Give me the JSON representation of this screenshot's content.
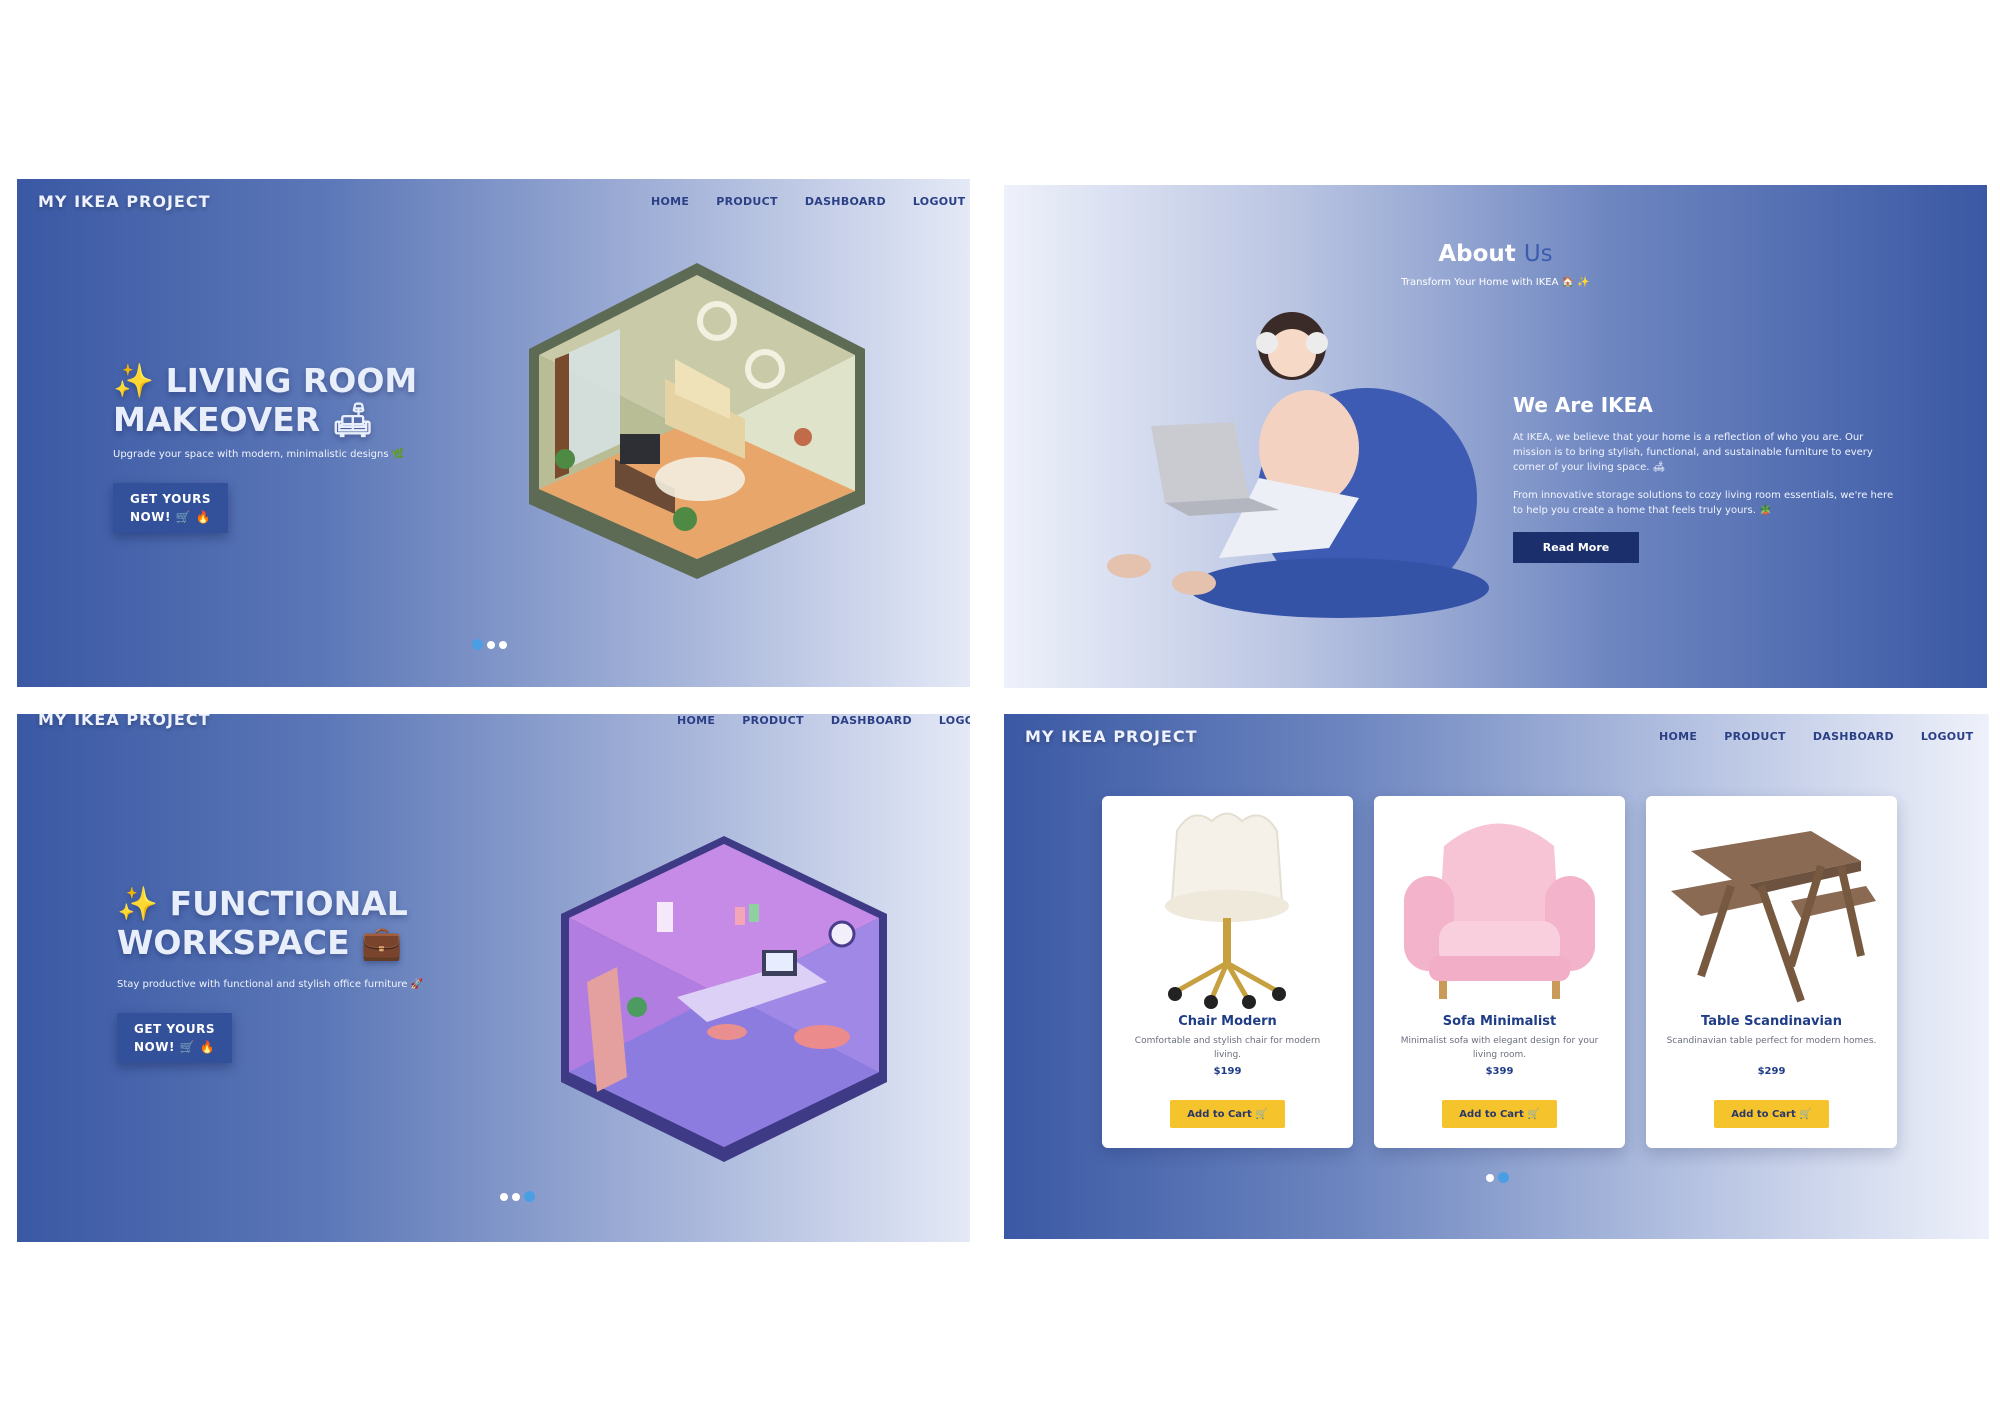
{
  "brand": "MY IKEA PROJECT",
  "nav": [
    "HOME",
    "PRODUCT",
    "DASHBOARD",
    "LOGOUT"
  ],
  "nav_p3_truncated": "LOGO",
  "slide1": {
    "title_line1": "✨ LIVING ROOM",
    "title_line2": "MAKEOVER 🛋",
    "subtitle": "Upgrade your space with modern, minimalistic designs 🌿",
    "cta_line1": "GET YOURS",
    "cta_line2": "NOW! 🛒 🔥",
    "dots": 3,
    "active_dot": 0
  },
  "about": {
    "title": "About",
    "title_accent": "Us",
    "subtitle": "Transform Your Home with IKEA 🏠 ✨",
    "heading": "We Are IKEA",
    "paragraph1": "At IKEA, we believe that your home is a reflection of who you are. Our mission is to bring stylish, functional, and sustainable furniture to every corner of your living space. 🛋",
    "paragraph2": "From innovative storage solutions to cozy living room essentials, we're here to help you create a home that feels truly yours. 🪴",
    "button": "Read More"
  },
  "slide3": {
    "title_line1": "✨ FUNCTIONAL",
    "title_line2": "WORKSPACE 💼",
    "subtitle": "Stay productive with functional and stylish office furniture 🚀",
    "cta_line1": "GET YOURS",
    "cta_line2": "NOW! 🛒 🔥",
    "dots": 3,
    "active_dot": 2
  },
  "products": [
    {
      "name": "Chair Modern",
      "description": "Comfortable and stylish chair for modern living.",
      "price": "$199",
      "button": "Add to Cart 🛒",
      "icon": "swivel-chair-icon"
    },
    {
      "name": "Sofa Minimalist",
      "description": "Minimalist sofa with elegant design for your living room.",
      "price": "$399",
      "button": "Add to Cart 🛒",
      "icon": "armchair-icon"
    },
    {
      "name": "Table Scandinavian",
      "description": "Scandinavian table perfect for modern homes.",
      "price": "$299",
      "button": "Add to Cart 🛒",
      "icon": "picnic-table-icon"
    }
  ],
  "products_dots": 2,
  "products_active_dot": 1,
  "colors": {
    "brand_blue": "#3a58a4",
    "nav_text": "#2b3f86",
    "active_dot": "#4a9fe4",
    "cart_button": "#f5c32c",
    "read_more": "#1a2f6b"
  }
}
